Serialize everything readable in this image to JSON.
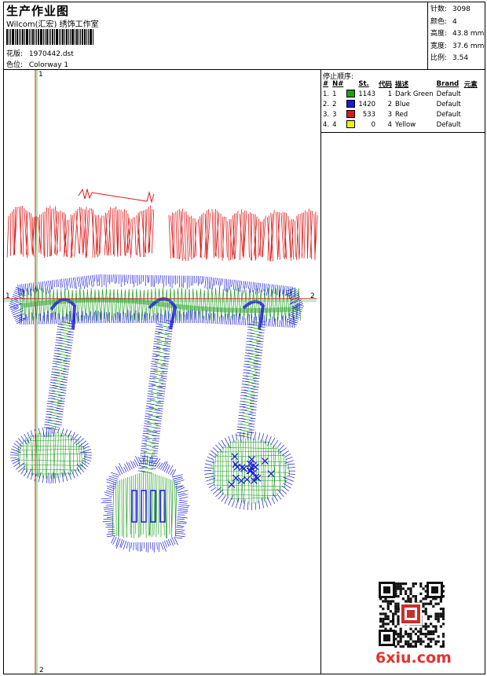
{
  "header": {
    "title": "生产作业图",
    "subtitle": "Wilcom(汇宏) 绣饰工作室",
    "design_label": "花版:",
    "design_value": "1970442.dst",
    "colorway_label": "色位:",
    "colorway_value": "Colorway 1"
  },
  "stats": [
    {
      "label": "针数:",
      "value": "3098"
    },
    {
      "label": "颜色:",
      "value": "4"
    },
    {
      "label": "高度:",
      "value": "43.8 mm"
    },
    {
      "label": "宽度:",
      "value": "37.6 mm"
    },
    {
      "label": "比例:",
      "value": "3.54"
    }
  ],
  "legend": {
    "title": "停止顺序:",
    "headers": [
      "#",
      "N#",
      "St.",
      "代码",
      "描述",
      "Brand",
      "元素"
    ],
    "rows": [
      {
        "idx": "1.",
        "n": "1",
        "color": "#1e9e1e",
        "st": "1143",
        "code": "1",
        "desc": "Dark Green",
        "brand": "Default"
      },
      {
        "idx": "2.",
        "n": "2",
        "color": "#1a1adc",
        "st": "1420",
        "code": "2",
        "desc": "Blue",
        "brand": "Default"
      },
      {
        "idx": "3.",
        "n": "3",
        "color": "#e01818",
        "st": "533",
        "code": "3",
        "desc": "Red",
        "brand": "Default"
      },
      {
        "idx": "4.",
        "n": "4",
        "color": "#f0f000",
        "st": "0",
        "code": "4",
        "desc": "Yellow",
        "brand": "Default"
      }
    ]
  },
  "axes": {
    "top": "1",
    "bottom": "2",
    "left": "1",
    "right": "2"
  },
  "watermark": "6xiu.com",
  "colors": {
    "green": "#1e9e1e",
    "blue": "#1a1adc",
    "red": "#e01818",
    "axis": "#d01010",
    "axis_green": "#30c030"
  }
}
